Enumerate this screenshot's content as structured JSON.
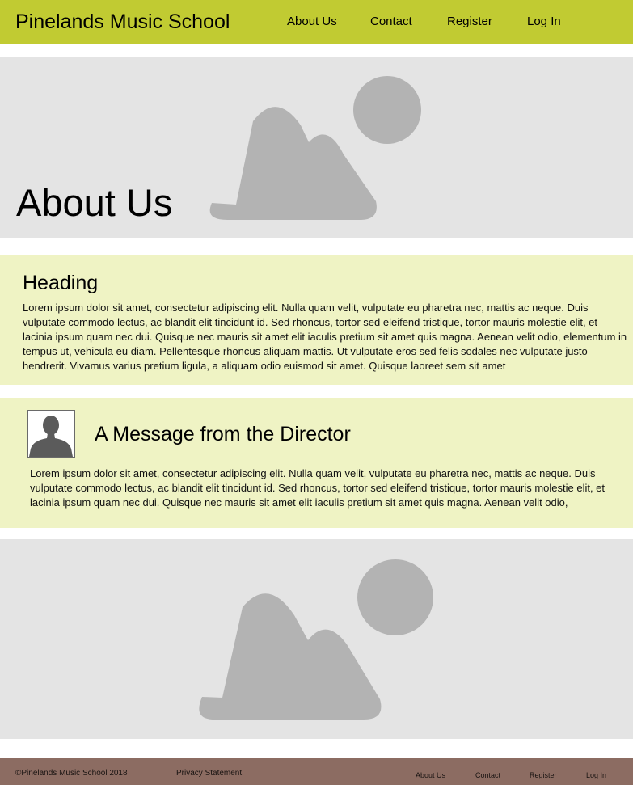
{
  "header": {
    "site_title": "Pinelands Music School",
    "nav": [
      "About Us",
      "Contact",
      "Register",
      "Log In"
    ]
  },
  "hero": {
    "title": "About Us",
    "image_icon": "image-placeholder-icon"
  },
  "section1": {
    "heading": "Heading",
    "body": "Lorem ipsum dolor sit amet, consectetur adipiscing elit. Nulla quam velit, vulputate eu pharetra nec, mattis ac neque. Duis vulputate commodo lectus, ac blandit elit tincidunt id. Sed rhoncus, tortor sed eleifend tristique, tortor mauris molestie elit, et lacinia ipsum quam nec dui. Quisque nec mauris sit amet elit iaculis pretium sit amet quis magna. Aenean velit odio, elementum in tempus ut, vehicula eu diam. Pellentesque rhoncus aliquam mattis. Ut vulputate eros sed felis sodales nec vulputate justo hendrerit. Vivamus varius pretium ligula, a aliquam odio euismod sit amet. Quisque laoreet sem sit amet"
  },
  "section2": {
    "heading": "A Message from the Director",
    "avatar_icon": "person-avatar-icon",
    "body": "Lorem ipsum dolor sit amet, consectetur adipiscing elit. Nulla quam velit, vulputate eu pharetra nec, mattis ac neque. Duis vulputate commodo lectus, ac blandit elit tincidunt id. Sed rhoncus, tortor sed eleifend tristique, tortor mauris molestie elit, et lacinia ipsum quam nec dui. Quisque nec mauris sit amet elit iaculis pretium sit amet quis magna. Aenean velit odio,"
  },
  "bottom_image": {
    "image_icon": "image-placeholder-icon"
  },
  "footer": {
    "copyright": "©Pinelands Music School 2018",
    "privacy": "Privacy Statement",
    "nav": [
      "About Us",
      "Contact",
      "Register",
      "Log In"
    ]
  },
  "colors": {
    "header_bg": "#c1cb32",
    "section_bg": "#eff3c4",
    "placeholder_bg": "#e4e4e4",
    "placeholder_shape": "#b3b3b3",
    "footer_bg": "#8c6c62"
  }
}
